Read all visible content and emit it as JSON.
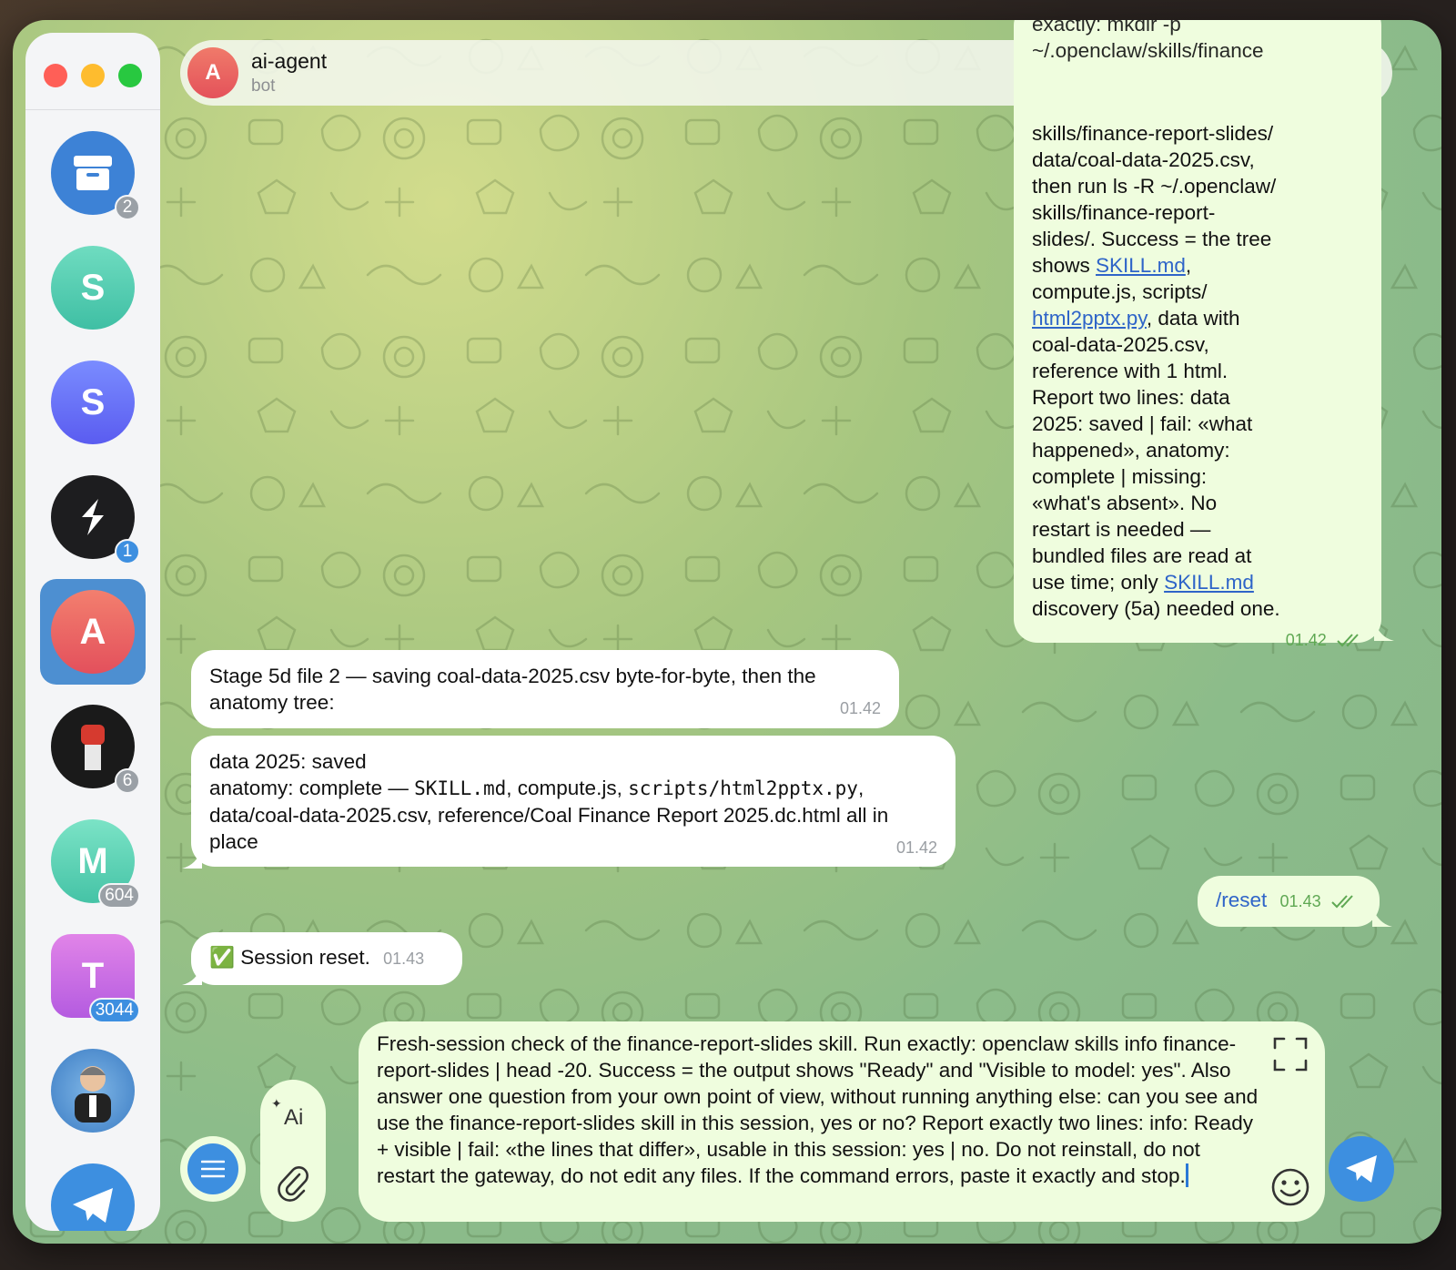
{
  "header": {
    "title": "ai-agent",
    "subtitle": "bot",
    "avatar_letter": "A"
  },
  "sidebar": {
    "items": [
      {
        "id": "archive",
        "badge": "2"
      },
      {
        "id": "s1",
        "letter": "S",
        "badge": ""
      },
      {
        "id": "s2",
        "letter": "S",
        "badge": ""
      },
      {
        "id": "s3",
        "badge": "1"
      },
      {
        "id": "ai-agent",
        "letter": "A",
        "badge": "",
        "active": true
      },
      {
        "id": "fist",
        "badge": "6"
      },
      {
        "id": "m",
        "letter": "M",
        "badge": "604"
      },
      {
        "id": "t",
        "letter": "T",
        "badge": "3044"
      },
      {
        "id": "person",
        "badge": ""
      },
      {
        "id": "telegram",
        "badge": ""
      }
    ]
  },
  "messages": {
    "m1": {
      "partial_top": "exactly: mkdir -p ~/.openclaw/skills/finance",
      "lines": [
        "skills/finance-report-slides/",
        "data/coal-data-2025.csv,",
        "then run ls -R ~/.openclaw/",
        "skills/finance-report-",
        "slides/. Success = the tree"
      ],
      "shows_prefix": "shows ",
      "link_skill": "SKILL.md",
      "shows_suffix": ",",
      "line_compute": "compute.js, scripts/",
      "link_html2pptx": "html2pptx.py",
      "html2pptx_suffix": ", data with",
      "lines2": [
        "coal-data-2025.csv,",
        "reference with 1 html.",
        "Report two lines: data",
        "2025: saved | fail: «what",
        "happened», anatomy:",
        "complete | missing:",
        "«what's absent». No",
        "restart is needed —",
        "bundled files are read at"
      ],
      "only_prefix": "use time; only ",
      "link_skill2": "SKILL.md",
      "last_line": "discovery (5a) needed one.",
      "time": "01.42"
    },
    "m2": {
      "text": "Stage 5d file 2 — saving coal-data-2025.csv byte-for-byte, then the anatomy tree:",
      "time": "01.42"
    },
    "m3": {
      "line1": "data 2025: saved",
      "anatomy_prefix": "anatomy: complete — ",
      "code1": "SKILL.md",
      "mid": ", compute.js, ",
      "code2": "scripts/html2pptx.py",
      "tail": ", data/coal-data-2025.csv, reference/Coal Finance Report 2025.dc.html all in place",
      "time": "01.42"
    },
    "m4": {
      "text": "/reset",
      "time": "01.43"
    },
    "m5": {
      "emoji": "✅",
      "text": "Session reset.",
      "time": "01.43"
    }
  },
  "composer": {
    "value": "Fresh-session check of the finance-report-slides skill. Run exactly: openclaw skills info finance-report-slides | head -20. Success = the output shows \"Ready\" and \"Visible to model: yes\". Also answer one question from your own point of view, without running anything else: can you see and use the finance-report-slides skill in this session, yes or no? Report exactly two lines: info: Ready + visible | fail: «the lines that differ», usable in this session: yes | no. Do not reinstall, do not restart the gateway, do not edit any files. If the command errors, paste it exactly and stop.",
    "ai_label": "Ai"
  },
  "colors": {
    "accent": "#3d8fe0",
    "outgoing": "#effdde",
    "incoming": "#ffffff",
    "link": "#2e64c8"
  }
}
